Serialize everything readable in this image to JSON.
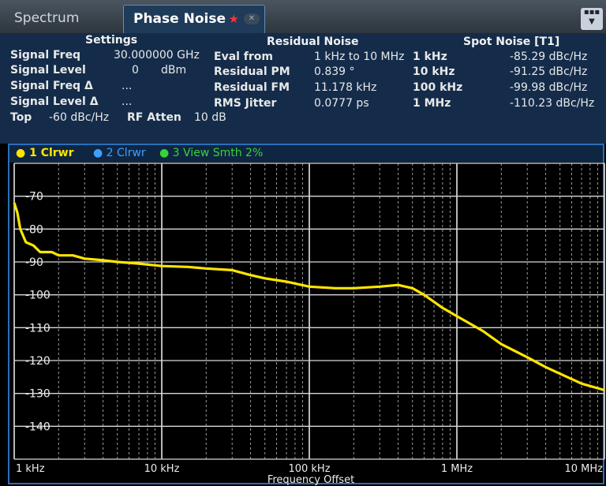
{
  "tabs": {
    "spectrum": "Spectrum",
    "phase_noise": "Phase Noise"
  },
  "settings": {
    "header": "Settings",
    "rows": [
      {
        "label": "Signal Freq",
        "value": "30.000000 GHz"
      },
      {
        "label": "Signal Level",
        "value": "0",
        "unit": "dBm"
      },
      {
        "label": "Signal Freq Δ",
        "value": "..."
      },
      {
        "label": "Signal Level Δ",
        "value": "..."
      }
    ],
    "top_label": "Top",
    "top_value": "-60 dBc/Hz",
    "rf_atten_label": "RF Atten",
    "rf_atten_value": "10 dB"
  },
  "residual_noise": {
    "header": "Residual Noise",
    "rows": [
      {
        "label": "Eval from",
        "value": "1 kHz to 10 MHz"
      },
      {
        "label": "Residual PM",
        "value": "0.839 °"
      },
      {
        "label": "Residual FM",
        "value": "11.178 kHz"
      },
      {
        "label": "RMS Jitter",
        "value": "0.0777 ps"
      }
    ]
  },
  "spot_noise": {
    "header": "Spot Noise [T1]",
    "rows": [
      {
        "offset": "1 kHz",
        "value": "-85.29 dBc/Hz"
      },
      {
        "offset": "10 kHz",
        "value": "-91.25 dBc/Hz"
      },
      {
        "offset": "100 kHz",
        "value": "-99.98 dBc/Hz"
      },
      {
        "offset": "1 MHz",
        "value": "-110.23 dBc/Hz"
      }
    ]
  },
  "legend": {
    "t1": "1 Clrwr",
    "t2": "2 Clrwr",
    "t3": "3 View Smth 2%",
    "t1_color": "#ffe600",
    "t2_color": "#3ea0ff",
    "t3_color": "#36d436"
  },
  "chart_data": {
    "type": "line",
    "xlabel": "Frequency Offset",
    "x_scale": "log",
    "xlim_hz": [
      1000,
      10000000
    ],
    "ylim": [
      -150,
      -60
    ],
    "x_ticks": [
      {
        "hz": 1000,
        "label": "1 kHz"
      },
      {
        "hz": 10000,
        "label": "10 kHz"
      },
      {
        "hz": 100000,
        "label": "100 kHz"
      },
      {
        "hz": 1000000,
        "label": "1 MHz"
      },
      {
        "hz": 10000000,
        "label": "10 MHz"
      }
    ],
    "y_ticks": [
      -70,
      -80,
      -90,
      -100,
      -110,
      -120,
      -130,
      -140
    ],
    "grid": true,
    "series": [
      {
        "color": "#ffe600",
        "points": [
          [
            1000,
            -72
          ],
          [
            1050,
            -75
          ],
          [
            1100,
            -80
          ],
          [
            1200,
            -84
          ],
          [
            1350,
            -85
          ],
          [
            1500,
            -87
          ],
          [
            1800,
            -87
          ],
          [
            2000,
            -88
          ],
          [
            2500,
            -88
          ],
          [
            3000,
            -89
          ],
          [
            4000,
            -89.5
          ],
          [
            5000,
            -90
          ],
          [
            7000,
            -90.5
          ],
          [
            10000,
            -91.25
          ],
          [
            15000,
            -91.5
          ],
          [
            20000,
            -92
          ],
          [
            30000,
            -92.5
          ],
          [
            40000,
            -94
          ],
          [
            50000,
            -95
          ],
          [
            70000,
            -96
          ],
          [
            100000,
            -97.5
          ],
          [
            150000,
            -98
          ],
          [
            200000,
            -98
          ],
          [
            300000,
            -97.5
          ],
          [
            400000,
            -97
          ],
          [
            500000,
            -98
          ],
          [
            600000,
            -100
          ],
          [
            800000,
            -104
          ],
          [
            1000000,
            -106.5
          ],
          [
            1500000,
            -111
          ],
          [
            2000000,
            -115
          ],
          [
            3000000,
            -119
          ],
          [
            4000000,
            -122
          ],
          [
            5000000,
            -124
          ],
          [
            7000000,
            -127
          ],
          [
            10000000,
            -129
          ]
        ]
      }
    ]
  }
}
